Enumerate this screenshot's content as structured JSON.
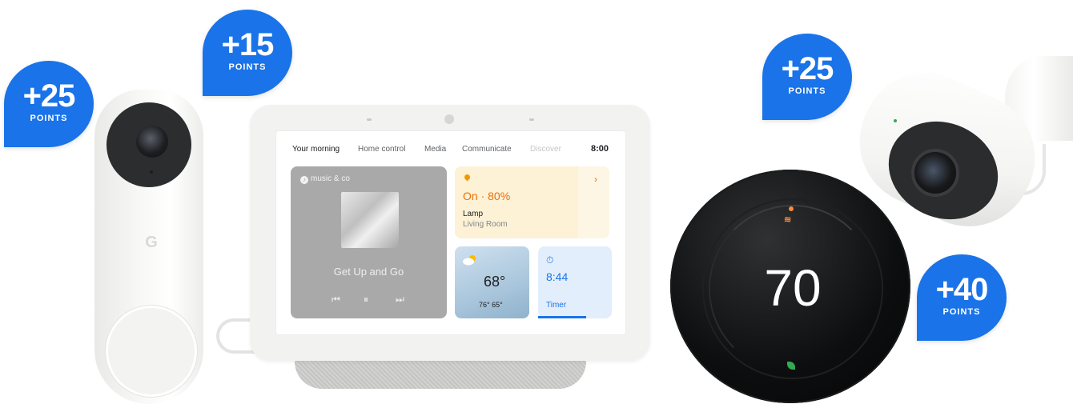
{
  "badges": [
    {
      "value": "+25",
      "label": "POINTS",
      "product": "doorbell"
    },
    {
      "value": "+15",
      "label": "POINTS",
      "product": "nest-hub"
    },
    {
      "value": "+25",
      "label": "POINTS",
      "product": "outdoor-camera"
    },
    {
      "value": "+40",
      "label": "POINTS",
      "product": "thermostat"
    }
  ],
  "doorbell": {
    "logo": "G"
  },
  "hub": {
    "tabs": [
      "Your morning",
      "Home control",
      "Media",
      "Communicate",
      "Discover"
    ],
    "clock": "8:00",
    "music": {
      "tag": "music & co",
      "title": "Get Up and Go",
      "controls": {
        "prev": "⏮",
        "pause": "⏸",
        "next": "⏭"
      }
    },
    "lamp": {
      "state": "On · 80%",
      "name": "Lamp",
      "room": "Living Room",
      "chevron": "›"
    },
    "weather": {
      "temp": "68°",
      "range": "76° 65°",
      "icon": "partly-cloudy-icon"
    },
    "timer": {
      "value": "8:44",
      "label": "Timer",
      "icon": "stopwatch-icon",
      "progress": 0.65
    }
  },
  "thermostat": {
    "temperature": "70",
    "mode_icon": "heat-icon",
    "eco_icon": "leaf-icon"
  },
  "colors": {
    "badge": "#1a73e8",
    "lamp_accent": "#e8710a",
    "timer_accent": "#1a73e8",
    "heat": "#ff8a3d",
    "eco": "#34a853"
  }
}
